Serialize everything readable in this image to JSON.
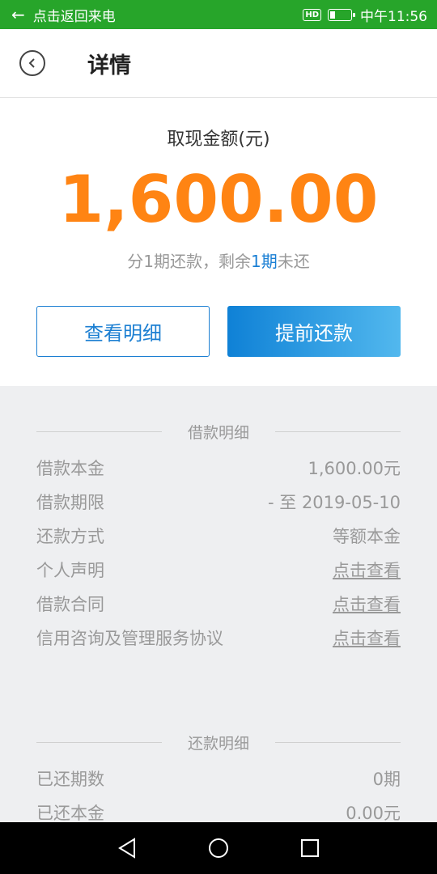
{
  "status_bar": {
    "back_text": "点击返回来电",
    "hd_label": "HD",
    "battery_level": 0.25,
    "clock": "中午11:56"
  },
  "header": {
    "title": "详情",
    "back_icon": "back-circle-icon"
  },
  "summary": {
    "amount_label": "取现金额(元)",
    "amount": "1,600.00",
    "installments_prefix": "分1期还款，剩余",
    "installments_highlight": "1期",
    "installments_suffix": "未还",
    "view_detail_label": "查看明细",
    "repay_early_label": "提前还款",
    "accent_color": "#ff8413",
    "brand_color": "#1c7fd2"
  },
  "loan_detail": {
    "heading": "借款明细",
    "rows": [
      {
        "label": "借款本金",
        "value": "1,600.00元",
        "link": false
      },
      {
        "label": "借款期限",
        "value": "- 至 2019-05-10",
        "link": false
      },
      {
        "label": "还款方式",
        "value": "等额本金",
        "link": false
      },
      {
        "label": "个人声明",
        "value": "点击查看",
        "link": true
      },
      {
        "label": "借款合同",
        "value": "点击查看",
        "link": true
      },
      {
        "label": "信用咨询及管理服务协议",
        "value": "点击查看",
        "link": true
      }
    ]
  },
  "repay_detail": {
    "heading": "还款明细",
    "rows": [
      {
        "label": "已还期数",
        "value": "0期"
      },
      {
        "label": "已还本金",
        "value": "0.00元"
      }
    ]
  },
  "nav_bar": {
    "icons": [
      "back-triangle-icon",
      "home-circle-icon",
      "recents-square-icon"
    ]
  }
}
